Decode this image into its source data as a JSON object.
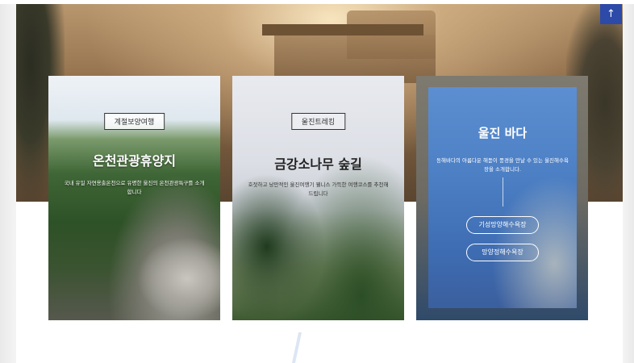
{
  "top_button": {
    "label": "↑"
  },
  "cards": [
    {
      "badge": "계절보양여행",
      "title": "온천관광휴양지",
      "description": "국내 유일 자연용출온천으로 유명한 울진의 온천관광특구를 소개합니다"
    },
    {
      "badge": "울진트레킹",
      "title": "금강소나무 숲길",
      "description": "호젓하고 낭만적인 울진여행기 웰니스 가득한 여행코스를 추천해드립니다"
    },
    {
      "title": "울진 바다",
      "description": "동해바다의 아름다운 해돋이 풍경을 만날 수 있는 울진해수욕장을 소개합니다.",
      "links": [
        "기성망양해수욕장",
        "망양정해수욕장"
      ]
    }
  ]
}
